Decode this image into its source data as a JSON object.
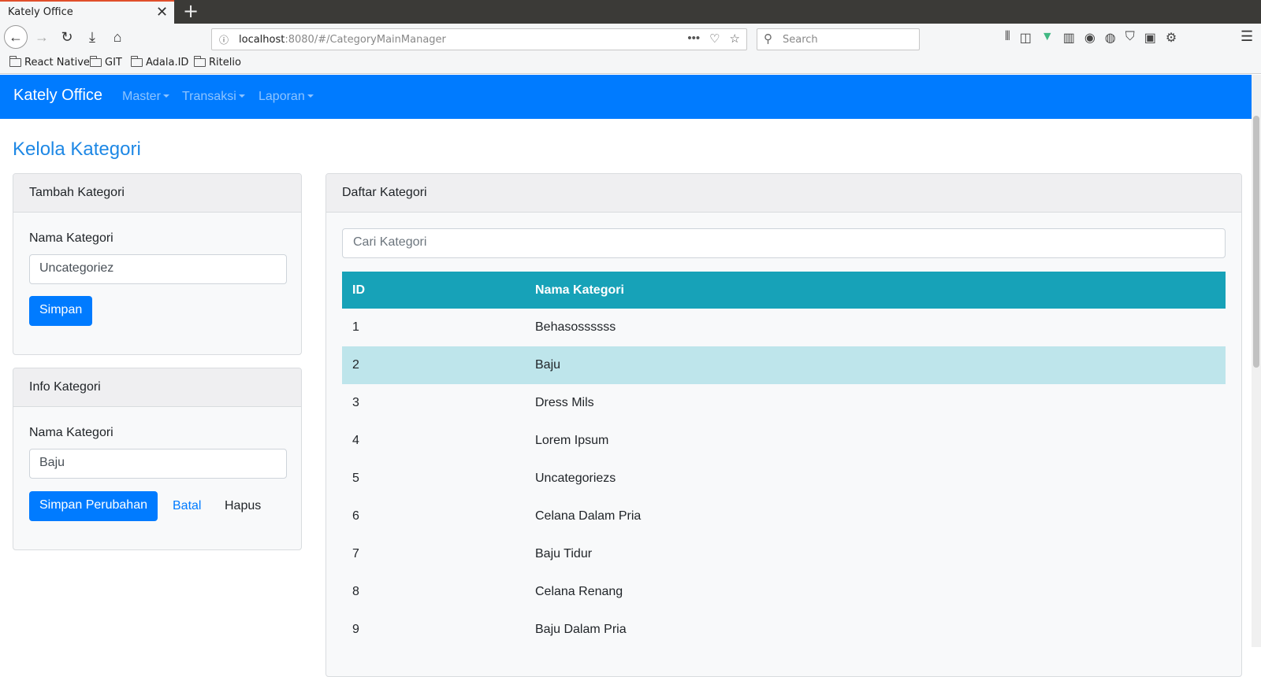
{
  "browser": {
    "tab_title": "Kately Office",
    "tab_close": "✕",
    "new_tab": "+",
    "url_host": "localhost",
    "url_rest": ":8080/#/CategoryMainManager",
    "search_placeholder": "Search",
    "bookmarks": [
      {
        "label": "React Native"
      },
      {
        "label": "GIT"
      },
      {
        "label": "Adala.ID"
      },
      {
        "label": "Ritelio"
      }
    ]
  },
  "app": {
    "brand": "Kately Office",
    "menu": [
      {
        "label": "Master"
      },
      {
        "label": "Transaksi"
      },
      {
        "label": "Laporan"
      }
    ],
    "page_title": "Kelola Kategori"
  },
  "add_card": {
    "header": "Tambah Kategori",
    "field_label": "Nama Kategori",
    "field_value": "Uncategoriez",
    "save_label": "Simpan"
  },
  "info_card": {
    "header": "Info Kategori",
    "field_label": "Nama Kategori",
    "field_value": "Baju",
    "save_label": "Simpan Perubahan",
    "cancel_label": "Batal",
    "delete_label": "Hapus"
  },
  "list_card": {
    "header": "Daftar Kategori",
    "search_placeholder": "Cari Kategori",
    "columns": [
      "ID",
      "Nama Kategori"
    ],
    "rows": [
      {
        "id": "1",
        "name": "Behasossssss"
      },
      {
        "id": "2",
        "name": "Baju",
        "selected": true
      },
      {
        "id": "3",
        "name": "Dress Mils"
      },
      {
        "id": "4",
        "name": "Lorem Ipsum"
      },
      {
        "id": "5",
        "name": "Uncategoriezs"
      },
      {
        "id": "6",
        "name": "Celana Dalam Pria"
      },
      {
        "id": "7",
        "name": "Baju Tidur"
      },
      {
        "id": "8",
        "name": "Celana Renang"
      },
      {
        "id": "9",
        "name": "Baju Dalam Pria"
      }
    ]
  },
  "colors": {
    "primary": "#007bff",
    "table_header": "#17a2b8",
    "row_selected": "#bee5eb",
    "title": "#1e88e5"
  }
}
